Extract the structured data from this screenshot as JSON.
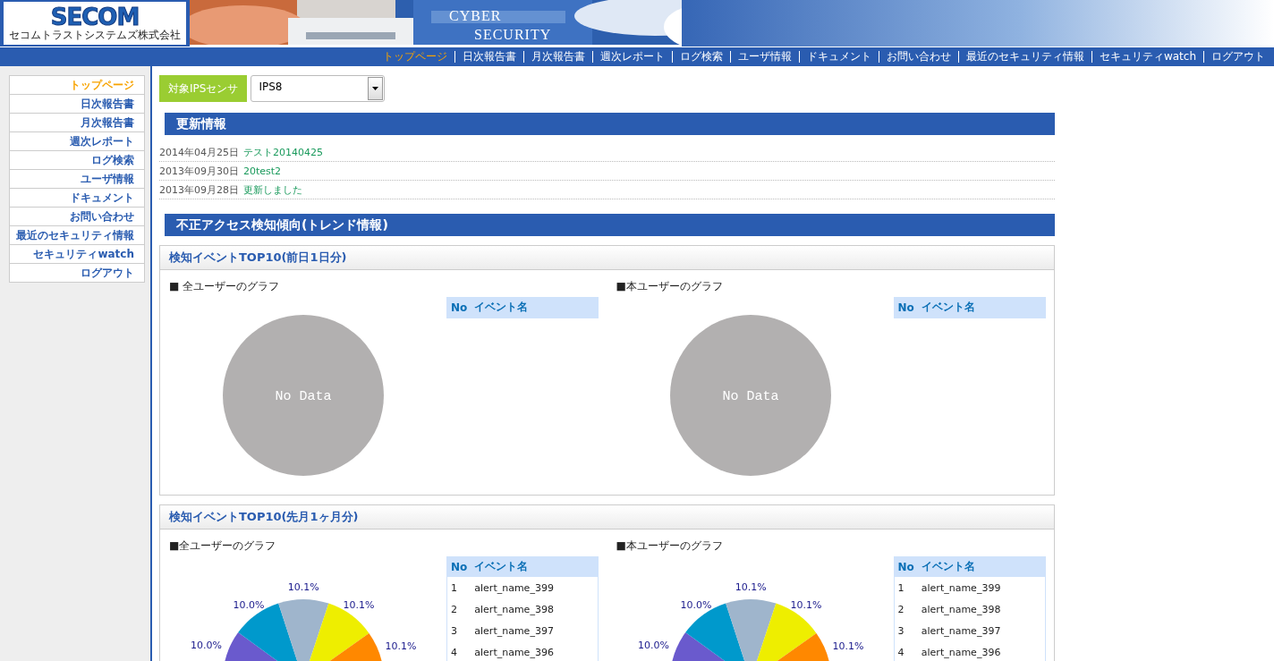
{
  "logo": {
    "name": "SECOM",
    "company": "セコムトラストシステムズ株式会社"
  },
  "banner": {
    "line_1": "CYBER",
    "line_2": "SECURITY"
  },
  "top_nav": [
    {
      "label": "トップページ",
      "selected": true
    },
    {
      "label": "日次報告書",
      "selected": false
    },
    {
      "label": "月次報告書",
      "selected": false
    },
    {
      "label": "週次レポート",
      "selected": false
    },
    {
      "label": "ログ検索",
      "selected": false
    },
    {
      "label": "ユーザ情報",
      "selected": false
    },
    {
      "label": "ドキュメント",
      "selected": false
    },
    {
      "label": "お問い合わせ",
      "selected": false
    },
    {
      "label": "最近のセキュリティ情報",
      "selected": false
    },
    {
      "label": "セキュリティwatch",
      "selected": false
    },
    {
      "label": "ログアウト",
      "selected": false
    }
  ],
  "sidebar": {
    "items": [
      {
        "label": "トップページ",
        "selected": true
      },
      {
        "label": "日次報告書",
        "selected": false
      },
      {
        "label": "月次報告書",
        "selected": false
      },
      {
        "label": "週次レポート",
        "selected": false
      },
      {
        "label": "ログ検索",
        "selected": false
      },
      {
        "label": "ユーザ情報",
        "selected": false
      },
      {
        "label": "ドキュメント",
        "selected": false
      },
      {
        "label": "お問い合わせ",
        "selected": false
      },
      {
        "label": "最近のセキュリティ情報",
        "selected": false
      },
      {
        "label": "セキュリティwatch",
        "selected": false
      },
      {
        "label": "ログアウト",
        "selected": false
      }
    ]
  },
  "sensor": {
    "label": "対象IPSセンサ",
    "value": "IPS8"
  },
  "news": {
    "title": "更新情報",
    "items": [
      {
        "date": "2014年04月25日",
        "title": "テスト20140425"
      },
      {
        "date": "2013年09月30日",
        "title": "20test2"
      },
      {
        "date": "2013年09月28日",
        "title": "更新しました"
      }
    ]
  },
  "trend": {
    "title": "不正アクセス検知傾向(トレンド情報)",
    "panels": [
      {
        "title": "検知イベントTOP10(前日1日分)",
        "graphs": [
          {
            "caption": "■ 全ユーザーのグラフ",
            "kind": "empty",
            "empty_text": "No Data",
            "columns": [
              "No",
              "イベント名"
            ]
          },
          {
            "caption": "■本ユーザーのグラフ",
            "kind": "empty",
            "empty_text": "No Data",
            "columns": [
              "No",
              "イベント名"
            ]
          }
        ]
      },
      {
        "title": "検知イベントTOP10(先月1ヶ月分)",
        "graphs": [
          {
            "caption": "■全ユーザーのグラフ",
            "kind": "pie",
            "chart_data": {
              "type": "pie",
              "values": [
                10.0,
                10.0,
                10.1,
                10.1,
                10.1
              ],
              "value_labels": [
                "10.0%",
                "10.0%",
                "10.1%",
                "10.1%",
                "10.1%"
              ],
              "data_labels": true
            },
            "columns": [
              "No",
              "イベント名"
            ],
            "rows": [
              [
                "1",
                "alert_name_399"
              ],
              [
                "2",
                "alert_name_398"
              ],
              [
                "3",
                "alert_name_397"
              ],
              [
                "4",
                "alert_name_396"
              ]
            ]
          },
          {
            "caption": "■本ユーザーのグラフ",
            "kind": "pie",
            "chart_data": {
              "type": "pie",
              "values": [
                10.0,
                10.0,
                10.1,
                10.1,
                10.1
              ],
              "value_labels": [
                "10.0%",
                "10.0%",
                "10.1%",
                "10.1%",
                "10.1%"
              ],
              "data_labels": true
            },
            "columns": [
              "No",
              "イベント名"
            ],
            "rows": [
              [
                "1",
                "alert_name_399"
              ],
              [
                "2",
                "alert_name_398"
              ],
              [
                "3",
                "alert_name_397"
              ],
              [
                "4",
                "alert_name_396"
              ]
            ]
          }
        ]
      }
    ]
  }
}
